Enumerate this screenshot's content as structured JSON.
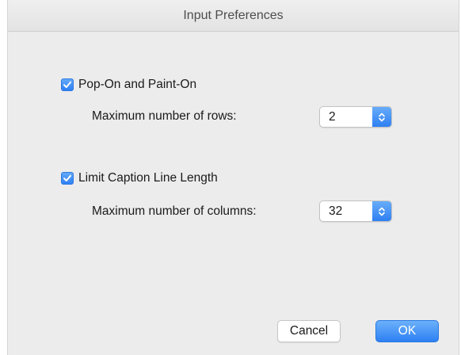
{
  "window": {
    "title": "Input Preferences"
  },
  "pop_on": {
    "checkbox_label": "Pop-On and Paint-On",
    "checked": true,
    "field_label": "Maximum number of rows:",
    "value": "2"
  },
  "caption_length": {
    "checkbox_label": "Limit Caption Line Length",
    "checked": true,
    "field_label": "Maximum number of columns:",
    "value": "32"
  },
  "buttons": {
    "cancel_label": "Cancel",
    "ok_label": "OK"
  },
  "colors": {
    "accent": "#2e80f3",
    "window_bg": "#ececec"
  },
  "icons": {
    "checkbox": "checkmark-icon",
    "stepper": "stepper-arrows-icon"
  }
}
